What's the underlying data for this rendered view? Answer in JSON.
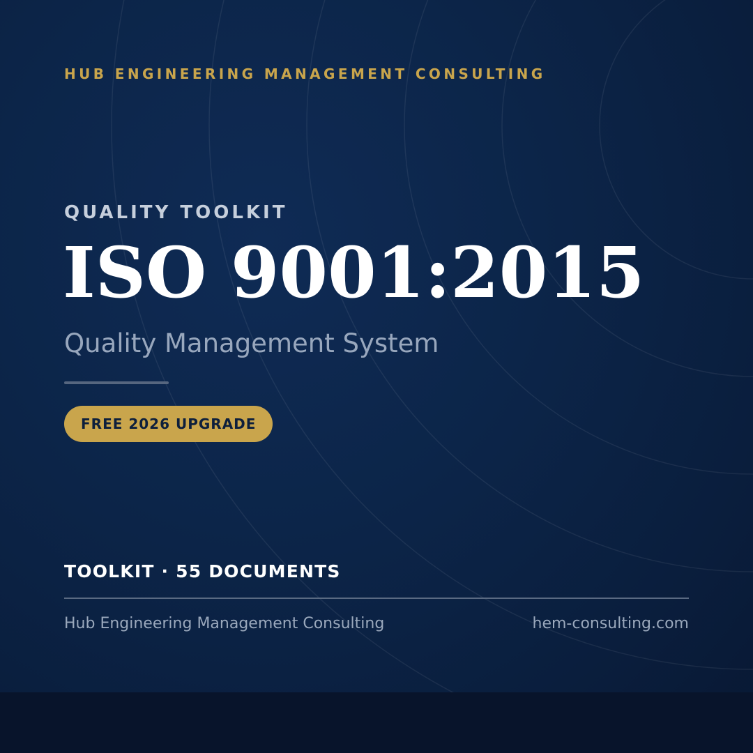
{
  "header": {
    "brand": "HUB ENGINEERING MANAGEMENT CONSULTING"
  },
  "hero": {
    "eyebrow": "QUALITY TOOLKIT",
    "title": "ISO 9001:2015",
    "subtitle": "Quality Management System",
    "badge": "FREE 2026 UPGRADE"
  },
  "meta": {
    "toolkit_label": "TOOLKIT · 55 DOCUMENTS"
  },
  "footer": {
    "company": "Hub Engineering Management Consulting",
    "website": "hem-consulting.com"
  },
  "colors": {
    "background": "#0c2549",
    "accent_gold": "#c9a54c",
    "title": "#ffffff",
    "muted": "#98a7bd"
  }
}
